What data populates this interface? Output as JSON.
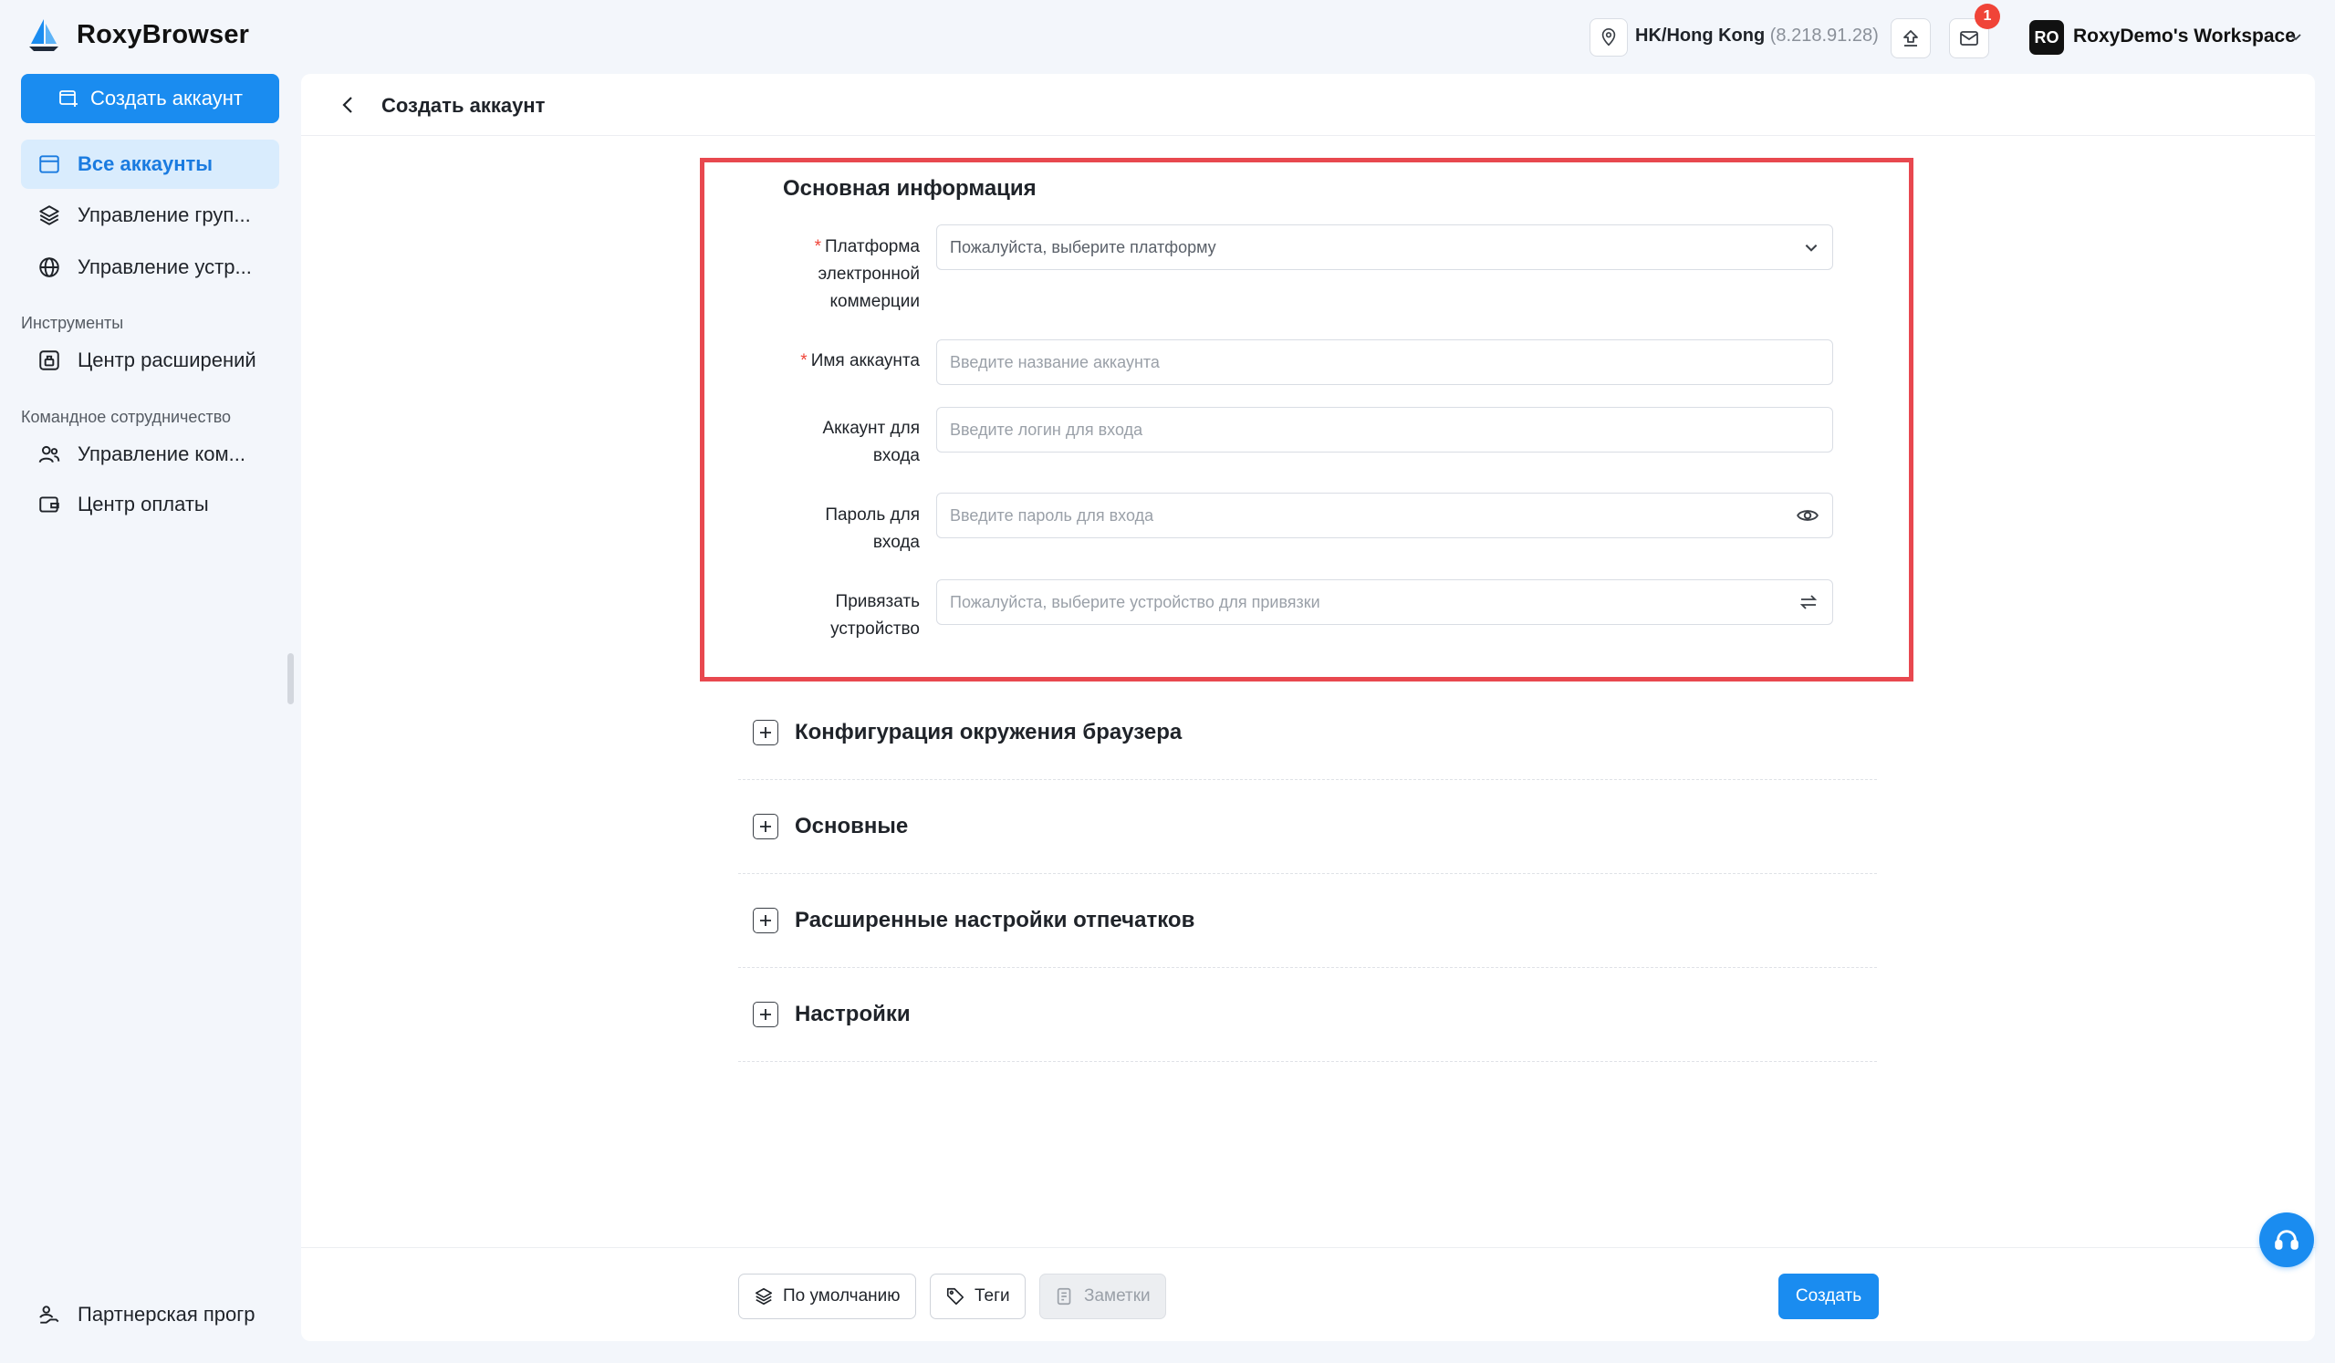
{
  "app": {
    "name": "RoxyBrowser"
  },
  "topbar": {
    "location": "HK/Hong Kong",
    "ip": "(8.218.91.28)",
    "notification_count": "1",
    "workspace_initials": "RO",
    "workspace_name": "RoxyDemo's Workspace"
  },
  "sidebar": {
    "create_label": "Создать аккаунт",
    "items": [
      {
        "label": "Все аккаунты"
      },
      {
        "label": "Управление груп..."
      },
      {
        "label": "Управление устр..."
      }
    ],
    "section_tools": "Инструменты",
    "tools": [
      {
        "label": "Центр расширений"
      }
    ],
    "section_team": "Командное сотрудничество",
    "team": [
      {
        "label": "Управление ком..."
      },
      {
        "label": "Центр оплаты"
      }
    ],
    "partner": "Партнерская прогр"
  },
  "page": {
    "title": "Создать аккаунт",
    "section_title": "Основная информация",
    "fields": {
      "platform": {
        "label": "Платформа электронной коммерции",
        "placeholder": "Пожалуйста, выберите платформу"
      },
      "account_name": {
        "label": "Имя аккаунта",
        "placeholder": "Введите название аккаунта"
      },
      "login": {
        "label": "Аккаунт для входа",
        "placeholder": "Введите логин для входа"
      },
      "password": {
        "label": "Пароль для входа",
        "placeholder": "Введите пароль для входа"
      },
      "device": {
        "label": "Привязать устройство",
        "placeholder": "Пожалуйста, выберите устройство для привязки"
      }
    },
    "collapsibles": [
      {
        "title": "Конфигурация окружения браузера"
      },
      {
        "title": "Основные"
      },
      {
        "title": "Расширенные настройки отпечатков"
      },
      {
        "title": "Настройки"
      }
    ],
    "footer": {
      "default_label": "По умолчанию",
      "tags_label": "Теги",
      "notes_label": "Заметки",
      "create_label": "Создать"
    }
  },
  "colors": {
    "accent": "#1a8cf0",
    "highlight": "#e8484f",
    "required": "#f04438"
  }
}
